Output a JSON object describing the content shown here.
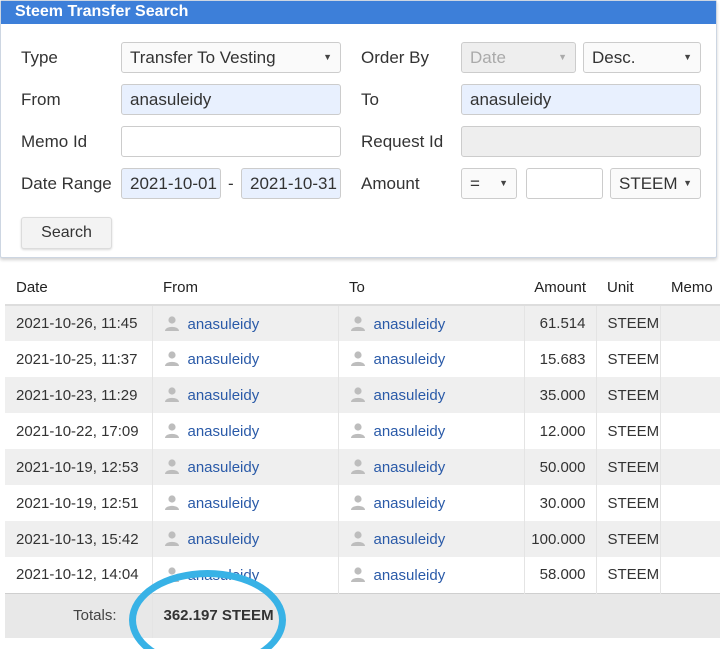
{
  "panel": {
    "title": "Steem Transfer Search",
    "type_label": "Type",
    "type_value": "Transfer To Vesting",
    "order_label": "Order By",
    "order_value": "Date",
    "direction_value": "Desc.",
    "from_label": "From",
    "from_value": "anasuleidy",
    "to_label": "To",
    "to_value": "anasuleidy",
    "memo_label": "Memo Id",
    "memo_value": "",
    "request_label": "Request Id",
    "request_value": "",
    "date_label": "Date Range",
    "date_from": "2021-10-01",
    "date_sep": "-",
    "date_to": "2021-10-31",
    "amount_label": "Amount",
    "amount_op": "=",
    "amount_value": "",
    "amount_unit": "STEEM",
    "search_label": "Search"
  },
  "table": {
    "headers": {
      "date": "Date",
      "from": "From",
      "to": "To",
      "amount": "Amount",
      "unit": "Unit",
      "memo": "Memo"
    },
    "rows": [
      {
        "date": "2021-10-26, 11:45",
        "from": "anasuleidy",
        "to": "anasuleidy",
        "amount": "61.514",
        "unit": "STEEM"
      },
      {
        "date": "2021-10-25, 11:37",
        "from": "anasuleidy",
        "to": "anasuleidy",
        "amount": "15.683",
        "unit": "STEEM"
      },
      {
        "date": "2021-10-23, 11:29",
        "from": "anasuleidy",
        "to": "anasuleidy",
        "amount": "35.000",
        "unit": "STEEM"
      },
      {
        "date": "2021-10-22, 17:09",
        "from": "anasuleidy",
        "to": "anasuleidy",
        "amount": "12.000",
        "unit": "STEEM"
      },
      {
        "date": "2021-10-19, 12:53",
        "from": "anasuleidy",
        "to": "anasuleidy",
        "amount": "50.000",
        "unit": "STEEM"
      },
      {
        "date": "2021-10-19, 12:51",
        "from": "anasuleidy",
        "to": "anasuleidy",
        "amount": "30.000",
        "unit": "STEEM"
      },
      {
        "date": "2021-10-13, 15:42",
        "from": "anasuleidy",
        "to": "anasuleidy",
        "amount": "100.000",
        "unit": "STEEM"
      },
      {
        "date": "2021-10-12, 14:04",
        "from": "anasuleidy",
        "to": "anasuleidy",
        "amount": "58.000",
        "unit": "STEEM"
      }
    ],
    "totals_label": "Totals:",
    "totals_value": "362.197 STEEM"
  },
  "annotation_color": "#38b2e6",
  "icons": {
    "user": "user-icon",
    "dropdown": "chevron-down-icon"
  }
}
